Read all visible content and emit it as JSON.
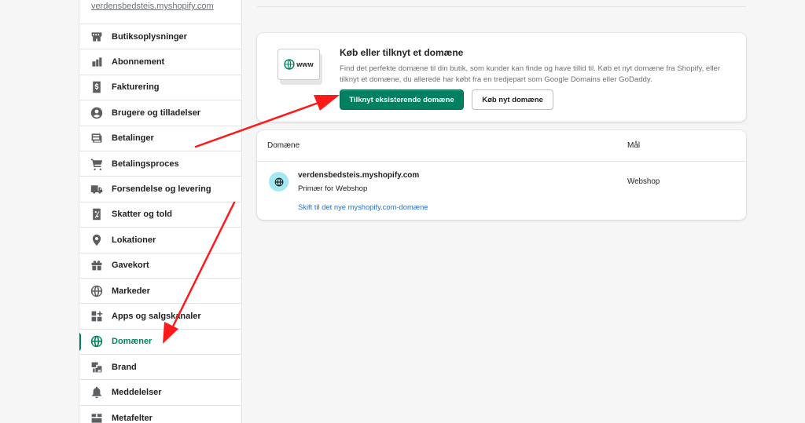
{
  "sidebar": {
    "store_url": "verdensbedsteis.myshopify.com",
    "items": [
      {
        "label": "Butiksoplysninger",
        "icon": "store-icon",
        "active": false
      },
      {
        "label": "Abonnement",
        "icon": "plan-icon",
        "active": false
      },
      {
        "label": "Fakturering",
        "icon": "billing-icon",
        "active": false
      },
      {
        "label": "Brugere og tilladelser",
        "icon": "user-icon",
        "active": false
      },
      {
        "label": "Betalinger",
        "icon": "payments-icon",
        "active": false
      },
      {
        "label": "Betalingsproces",
        "icon": "cart-icon",
        "active": false
      },
      {
        "label": "Forsendelse og levering",
        "icon": "truck-icon",
        "active": false
      },
      {
        "label": "Skatter og told",
        "icon": "tax-icon",
        "active": false
      },
      {
        "label": "Lokationer",
        "icon": "location-pin-icon",
        "active": false
      },
      {
        "label": "Gavekort",
        "icon": "gift-icon",
        "active": false
      },
      {
        "label": "Markeder",
        "icon": "globe-icon",
        "active": false
      },
      {
        "label": "Apps og salgskanaler",
        "icon": "apps-icon",
        "active": false
      },
      {
        "label": "Domæner",
        "icon": "domain-globe-icon",
        "active": true
      },
      {
        "label": "Brand",
        "icon": "brand-icon",
        "active": false
      },
      {
        "label": "Meddelelser",
        "icon": "bell-icon",
        "active": false
      },
      {
        "label": "Metafelter",
        "icon": "metafields-icon",
        "active": false
      }
    ]
  },
  "buy_card": {
    "title": "Køb eller tilknyt et domæne",
    "description": "Find det perfekte domæne til din butik, som kunder kan finde og have tillid til. Køb et nyt domæne fra Shopify, eller tilknyt et domæne, du allerede har købt fra en tredjepart som Google Domains eller GoDaddy.",
    "illustration_text": "www",
    "primary_button": "Tilknyt eksisterende domæne",
    "secondary_button": "Køb nyt domæne"
  },
  "domains_card": {
    "col_domain": "Domæne",
    "col_target": "Mål",
    "rows": [
      {
        "domain": "verdensbedsteis.myshopify.com",
        "subtitle": "Primær for Webshop",
        "link": "Skift til det nye myshopify.com-domæne",
        "target": "Webshop"
      }
    ]
  },
  "colors": {
    "accent": "#008060",
    "link": "#2c6ecb",
    "arrow": "#ff1a1a",
    "globe_bg": "#a4e8f2"
  }
}
